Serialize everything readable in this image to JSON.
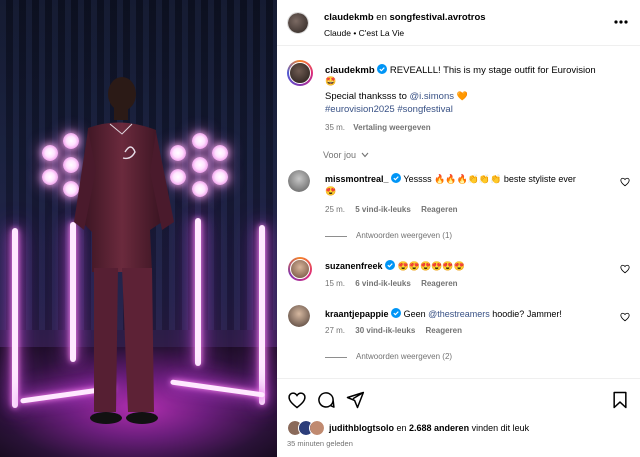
{
  "post": {
    "header": {
      "author": "claudekmb",
      "connector": "en",
      "collaborator": "songfestival.avrotros",
      "subtitle_user": "Claude",
      "subtitle_sep": "•",
      "subtitle_song": "C'est La Vie",
      "more_icon": "more-horizontal-icon"
    },
    "caption": {
      "author": "claudekmb",
      "text": "REVEALLL! This is my stage outfit for Eurovision",
      "emoji_1": "🤩",
      "line2_prefix": "Special thanksss to",
      "mention": "@i.simons",
      "emoji_2": "🧡",
      "hashtags": "#eurovision2025 #songfestival",
      "time": "35 m.",
      "translate": "Vertaling weergeven"
    },
    "comments_filter": "Voor jou",
    "comments": [
      {
        "user": "missmontreal_",
        "text_before": "Yessss",
        "emojis_mid": "🔥🔥🔥👏👏👏",
        "text_after": "beste styliste ever",
        "line2": "😍",
        "time": "25 m.",
        "likes": "5 vind-ik-leuks",
        "reply": "Reageren",
        "view_replies": "Antwoorden weergeven (1)"
      },
      {
        "user": "suzanenfreek",
        "text_before": "",
        "emojis_mid": "😍😍😍😍😍😍",
        "text_after": "",
        "time": "15 m.",
        "likes": "6 vind-ik-leuks",
        "reply": "Reageren"
      },
      {
        "user": "kraantjepappie",
        "text_before": "Geen",
        "mention": "@thestreamers",
        "text_after": "hoodie? Jammer!",
        "time": "27 m.",
        "likes": "30 vind-ik-leuks",
        "reply": "Reageren",
        "view_replies": "Antwoorden weergeven (2)"
      }
    ],
    "actions": {
      "like_icon": "heart-icon",
      "comment_icon": "comment-icon",
      "share_icon": "send-icon",
      "save_icon": "bookmark-icon"
    },
    "likes_line": {
      "user": "judithblogtsolo",
      "connector": "en",
      "count": "2.688 anderen",
      "suffix": "vinden dit leuk"
    },
    "posted_time": "35 minuten geleden"
  },
  "colors": {
    "accent_link": "#385185",
    "verified": "#0095f6",
    "muted": "#737373"
  }
}
